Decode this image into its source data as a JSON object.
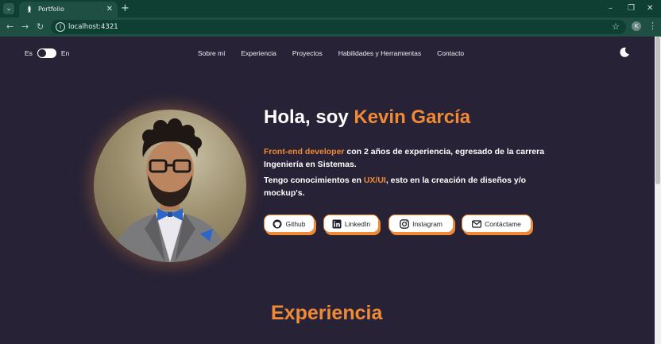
{
  "browser": {
    "tab_title": "Portfolio",
    "url": "localhost:4321",
    "profile_initial": "K"
  },
  "header": {
    "lang_left": "Es",
    "lang_right": "En",
    "nav": [
      "Sobre mí",
      "Experiencia",
      "Proyectos",
      "Habilidades y Herramientas",
      "Contacto"
    ],
    "theme_icon": "moon-icon"
  },
  "hero": {
    "greeting": "Hola, soy ",
    "name": "Kevin García",
    "bio1_accent": "Front-end developer",
    "bio1_rest": " con 2 años de experiencia, egresado de la carrera Ingeniería en Sistemas.",
    "bio2_start": "Tengo conocimientos en ",
    "bio2_accent": "UX/UI",
    "bio2_rest": ", esto en la creación de diseños y/o mockup's.",
    "buttons": [
      {
        "label": "Github",
        "icon": "github-icon"
      },
      {
        "label": "LinkedIn",
        "icon": "linkedin-icon"
      },
      {
        "label": "Instagram",
        "icon": "instagram-icon"
      },
      {
        "label": "Contáctame",
        "icon": "mail-icon"
      }
    ]
  },
  "sections": {
    "experience_title": "Experiencia"
  },
  "colors": {
    "background": "#272236",
    "accent": "#f08a35",
    "text": "#ffffff"
  }
}
